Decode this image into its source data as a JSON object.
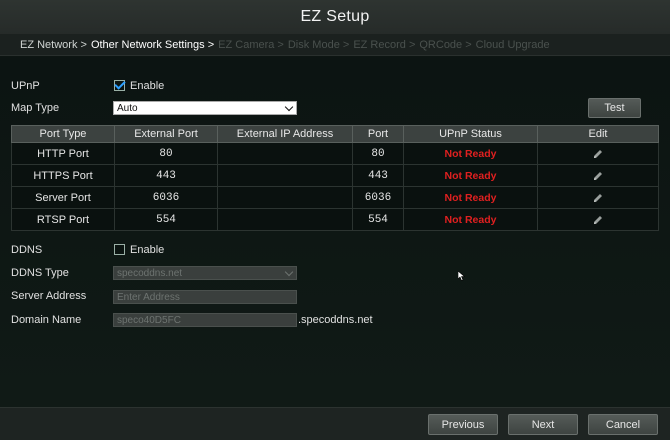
{
  "title": "EZ Setup",
  "steps": [
    {
      "label": "EZ Network >",
      "state": "done"
    },
    {
      "label": "Other Network Settings >",
      "state": "current"
    },
    {
      "label": "EZ Camera >",
      "state": "future"
    },
    {
      "label": "Disk Mode >",
      "state": "future"
    },
    {
      "label": "EZ Record >",
      "state": "future"
    },
    {
      "label": "QRCode >",
      "state": "future"
    },
    {
      "label": "Cloud Upgrade",
      "state": "future"
    }
  ],
  "upnp": {
    "label": "UPnP",
    "enable_label": "Enable",
    "enabled": true,
    "map_type_label": "Map Type",
    "map_type_value": "Auto",
    "test_button": "Test"
  },
  "port_table": {
    "headers": [
      "Port Type",
      "External Port",
      "External IP Address",
      "Port",
      "UPnP Status",
      "Edit"
    ],
    "rows": [
      {
        "type": "HTTP Port",
        "external_port": "80",
        "external_ip": "",
        "port": "80",
        "status": "Not Ready"
      },
      {
        "type": "HTTPS Port",
        "external_port": "443",
        "external_ip": "",
        "port": "443",
        "status": "Not Ready"
      },
      {
        "type": "Server Port",
        "external_port": "6036",
        "external_ip": "",
        "port": "6036",
        "status": "Not Ready"
      },
      {
        "type": "RTSP Port",
        "external_port": "554",
        "external_ip": "",
        "port": "554",
        "status": "Not Ready"
      }
    ],
    "status_color": "#e02020",
    "edit_icon": "pencil-icon"
  },
  "ddns": {
    "label": "DDNS",
    "enable_label": "Enable",
    "enabled": false,
    "type_label": "DDNS Type",
    "type_value": "specoddns.net",
    "server_address_label": "Server Address",
    "server_address_placeholder": "Enter Address",
    "domain_name_label": "Domain Name",
    "domain_name_value": "speco40D5FC",
    "domain_suffix": ".specoddns.net"
  },
  "footer": {
    "previous": "Previous",
    "next": "Next",
    "cancel": "Cancel"
  }
}
